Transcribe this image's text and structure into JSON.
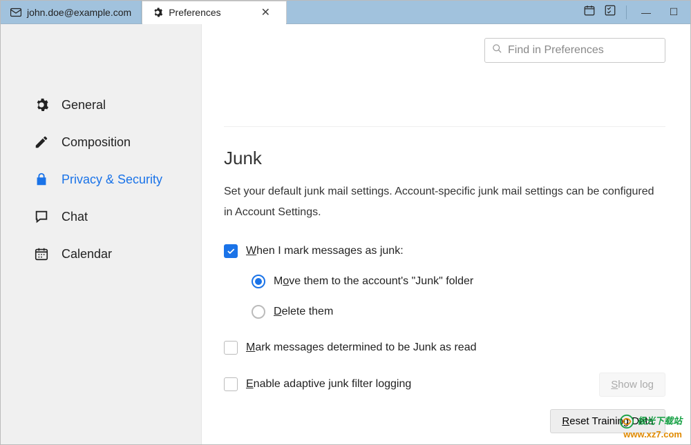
{
  "tabs": {
    "account": {
      "label": "john.doe@example.com"
    },
    "prefs": {
      "label": "Preferences"
    }
  },
  "sidebar": {
    "items": [
      {
        "label": "General"
      },
      {
        "label": "Composition"
      },
      {
        "label": "Privacy & Security"
      },
      {
        "label": "Chat"
      },
      {
        "label": "Calendar"
      }
    ]
  },
  "search": {
    "placeholder": "Find in Preferences"
  },
  "junk": {
    "heading": "Junk",
    "description": "Set your default junk mail settings. Account-specific junk mail settings can be configured in Account Settings.",
    "when_mark": {
      "prefix": "W",
      "rest": "hen I mark messages as junk:",
      "checked": true
    },
    "move": {
      "prefix": "M",
      "mid_u": "o",
      "rest_a": "ve them to the account's \"Junk\" folder",
      "selected": true
    },
    "delete": {
      "prefix": "D",
      "rest": "elete them",
      "selected": false
    },
    "mark_read": {
      "prefix": "M",
      "rest": "ark messages determined to be Junk as read",
      "checked": false
    },
    "enable_log": {
      "prefix": "E",
      "rest": "nable adaptive junk filter logging",
      "checked": false
    },
    "show_log": {
      "prefix": "S",
      "rest": "how log",
      "enabled": false
    },
    "reset": {
      "prefix": "R",
      "rest": "eset Training Data"
    }
  },
  "watermark": {
    "line1": "极光下载站",
    "line2": "www.xz7.com"
  }
}
